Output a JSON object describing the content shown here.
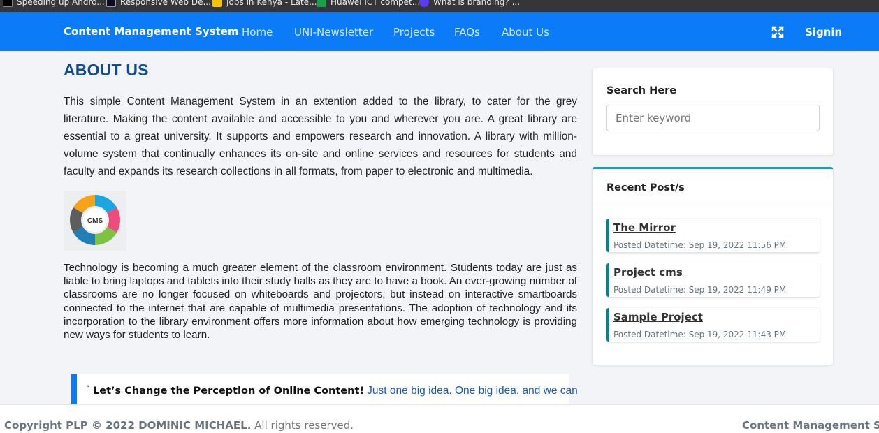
{
  "bookmarks": [
    {
      "label": "Speeding up Andro...",
      "icon": "dev-icon"
    },
    {
      "label": "Responsive Web De...",
      "icon": "free-code-camp-icon"
    },
    {
      "label": "Jobs in Kenya - Late...",
      "icon": "jobs-icon"
    },
    {
      "label": "Huawei ICT compet...",
      "icon": "huawei-icon"
    },
    {
      "label": "What is branding? ...",
      "icon": "globe-icon"
    }
  ],
  "navbar": {
    "brand": "Content Management System",
    "links": [
      "Home",
      "UNI-Newsletter",
      "Projects",
      "FAQs",
      "About Us"
    ],
    "expand_icon": "expand-icon",
    "signin": "Signin",
    "color": "#0b7bf8"
  },
  "main": {
    "title": "ABOUT US",
    "paragraph1": "This simple Content Management System in an extention added to the library, to cater for the grey literature. Making the content available and accessible to you and wherever you are. A great library are essential to a great university. It supports and empowers research and innovation. A library with million-volume system that continually enhances its on-site and online services and resources for students and faculty and expands its research collections in all formats, from paper to electronic and multimedia.",
    "image_label": "CMS",
    "paragraph2": "Technology is becoming a much greater element of the classroom environment. Students today are just as liable to bring laptops and tablets into their study halls as they are to have a book. An ever-growing number of classrooms are no longer focused on whiteboards and projectors, but instead on interactive smartboards connected to the internet that are capable of multimedia presentations. The adoption of technology and its incorporation to the library environment offers more information about how emerging technology is providing new ways for students to learn.",
    "quote": {
      "mark": "“",
      "strong": "Let’s Change the Perception of Online Content!",
      "text": "Just one big idea. One big idea, and we can"
    }
  },
  "sidebar": {
    "search": {
      "label": "Search Here",
      "placeholder": "Enter keyword",
      "value": ""
    },
    "recent": {
      "title": "Recent Post/s",
      "posts": [
        {
          "title": "The Mirror",
          "date": "Posted Datetime: Sep 19, 2022 11:56 PM"
        },
        {
          "title": "Project cms",
          "date": "Posted Datetime: Sep 19, 2022 11:49 PM"
        },
        {
          "title": "Sample Project",
          "date": "Posted Datetime: Sep 19, 2022 11:43 PM"
        }
      ]
    }
  },
  "footer": {
    "copyright_strong": "Copyright PLP © 2022 DOMINIC MICHAEL.",
    "copyright_rest": " All rights reserved.",
    "brand": "Content Management System"
  }
}
